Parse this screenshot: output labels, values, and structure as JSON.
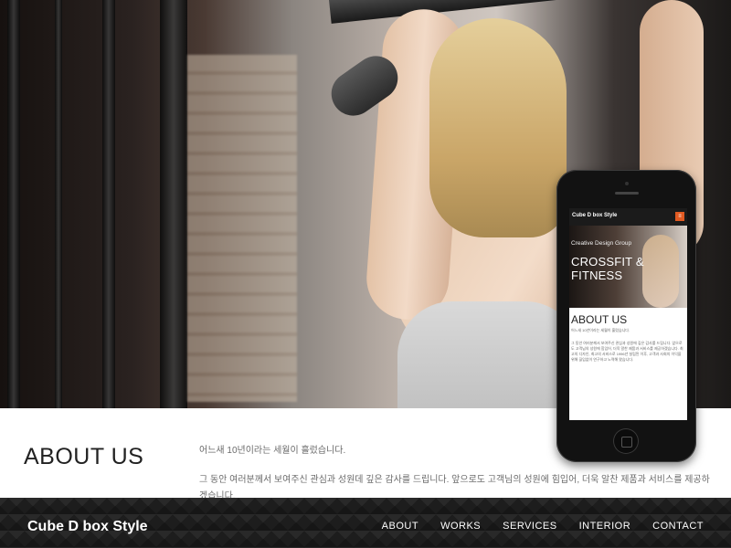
{
  "site": {
    "brand": "Cube D box Style"
  },
  "nav": {
    "items": [
      "ABOUT",
      "WORKS",
      "SERVICES",
      "INTERIOR",
      "CONTACT"
    ]
  },
  "about": {
    "title": "ABOUT US",
    "paragraph1": "어느새 10년이라는 세월이 흘렀습니다.",
    "paragraph2": "그 동안 여러분께서 보여주신 관심과 성원데 깊은 감사를 드립니다. 앞으로도 고객님의 성원에 힘입어, 더욱 알찬 제품과 서비스를 제공하겠습니다."
  },
  "phone": {
    "brand": "Cube D box Style",
    "menu_icon": "menu-icon",
    "tagline": "Creative Design Group",
    "headline": "CROSSFIT & FITNESS",
    "about_title": "ABOUT US",
    "p1": "어느새 10년이라는 세월이 흘렀습니다.",
    "p2": "그 동안 여러분께서 보여주신 관심과 성원에 깊은 감사를 드립니다. 앞으로도 고객님의 성원에 힘입어, 더욱 알찬 제품과 서비스를 제공하겠습니다. 최고의 디자인, 최고의 서비스로 1996년 설립된 이후, 고객과 사회의 이익을 위해 끊임없이 연구하고 노력해 왔습니다."
  },
  "colors": {
    "accent": "#e15a22",
    "footer_bg": "#1d1d1d",
    "text_dark": "#222222",
    "text_muted": "#6b6b6b"
  }
}
